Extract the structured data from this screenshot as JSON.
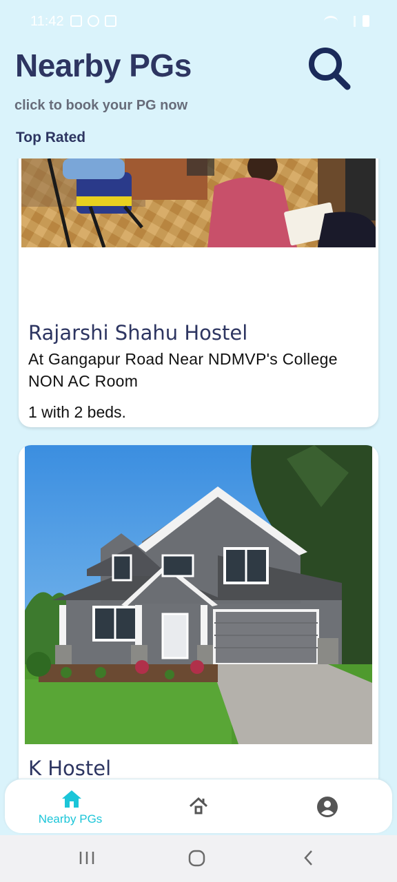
{
  "status_bar": {
    "time": "11:42"
  },
  "header": {
    "title": "Nearby PGs",
    "subtitle": "click to book your PG now",
    "section": "Top Rated"
  },
  "cards": [
    {
      "title": "Rajarshi Shahu Hostel",
      "address": "At Gangapur Road Near NDMVP's College",
      "room_type": "NON AC Room",
      "beds": "1 with 2 beds."
    },
    {
      "title": "K Hostel"
    }
  ],
  "bottom_nav": {
    "items": [
      {
        "label": "Nearby PGs",
        "icon": "home-icon",
        "active": true
      },
      {
        "label": "",
        "icon": "house-icon",
        "active": false
      },
      {
        "label": "",
        "icon": "account-icon",
        "active": false
      }
    ]
  },
  "colors": {
    "background": "#daf3fb",
    "title": "#2d3561",
    "accent": "#1bc5d8",
    "search_icon": "#1a2a5a"
  }
}
